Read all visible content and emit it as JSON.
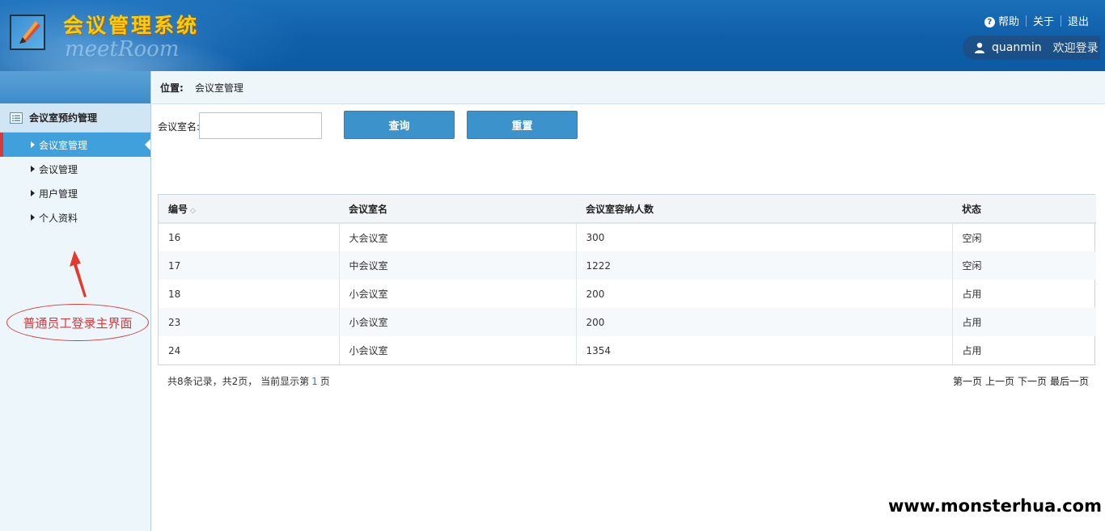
{
  "header": {
    "title": "会议管理系统",
    "subtitle": "meetRoom",
    "links": {
      "help": "帮助",
      "about": "关于",
      "logout": "退出"
    },
    "user": {
      "name": "quanmin",
      "welcome": "欢迎登录"
    }
  },
  "sidebar": {
    "group": "会议室预约管理",
    "items": [
      {
        "label": "会议室管理",
        "active": true
      },
      {
        "label": "会议管理"
      },
      {
        "label": "用户管理"
      },
      {
        "label": "个人资料"
      }
    ],
    "annotation": "普通员工登录主界面"
  },
  "breadcrumb": {
    "key": "位置:",
    "value": "会议室管理"
  },
  "search": {
    "label": "会议室名:",
    "value": "",
    "query_button": "查询",
    "reset_button": "重置"
  },
  "table": {
    "headers": [
      "编号",
      "会议室名",
      "会议室容纳人数",
      "状态"
    ],
    "rows": [
      [
        "16",
        "大会议室",
        "300",
        "空闲"
      ],
      [
        "17",
        "中会议室",
        "1222",
        "空闲"
      ],
      [
        "18",
        "小会议室",
        "200",
        "占用"
      ],
      [
        "23",
        "小会议室",
        "200",
        "占用"
      ],
      [
        "24",
        "小会议室",
        "1354",
        "占用"
      ]
    ]
  },
  "pager": {
    "summary_prefix": "共8条记录，共2页，  当前显示第",
    "current_page": "1",
    "summary_suffix": "页",
    "first": "第一页",
    "prev": "上一页",
    "next": "下一页",
    "last": "最后一页"
  },
  "watermark": "www.monsterhua.com",
  "colors": {
    "accent": "#3c93cc",
    "header": "#0f5ea9",
    "active_item": "#3fa0dc",
    "annotation": "#d43b3b"
  }
}
